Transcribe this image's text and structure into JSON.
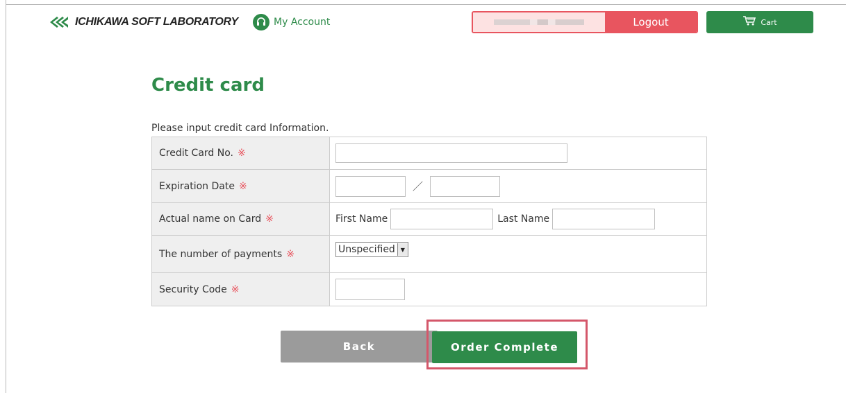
{
  "header": {
    "brand": "ICHIKAWA SOFT LABORATORY",
    "my_account_label": "My Account",
    "logout_label": "Logout",
    "cart_label": "Cart",
    "icons": {
      "logo": "diamond-logo-icon",
      "account": "headset-icon",
      "cart": "shopping-cart-icon"
    }
  },
  "page": {
    "title": "Credit card",
    "instruction": "Please input credit card Information."
  },
  "form": {
    "required_mark": "※",
    "rows": [
      {
        "label": "Credit Card No."
      },
      {
        "label": "Expiration Date",
        "separator": "／"
      },
      {
        "label": "Actual name on Card",
        "first_name_label": "First Name",
        "last_name_label": "Last Name"
      },
      {
        "label": "The number of payments",
        "selected": "Unspecified"
      },
      {
        "label": "Security Code"
      }
    ]
  },
  "actions": {
    "back_label": "Back",
    "order_label": "Order Complete"
  },
  "colors": {
    "brand_green": "#2e8b4a",
    "logout_red": "#e8555f",
    "highlight": "#d4576a",
    "back_gray": "#9b9b9b"
  }
}
